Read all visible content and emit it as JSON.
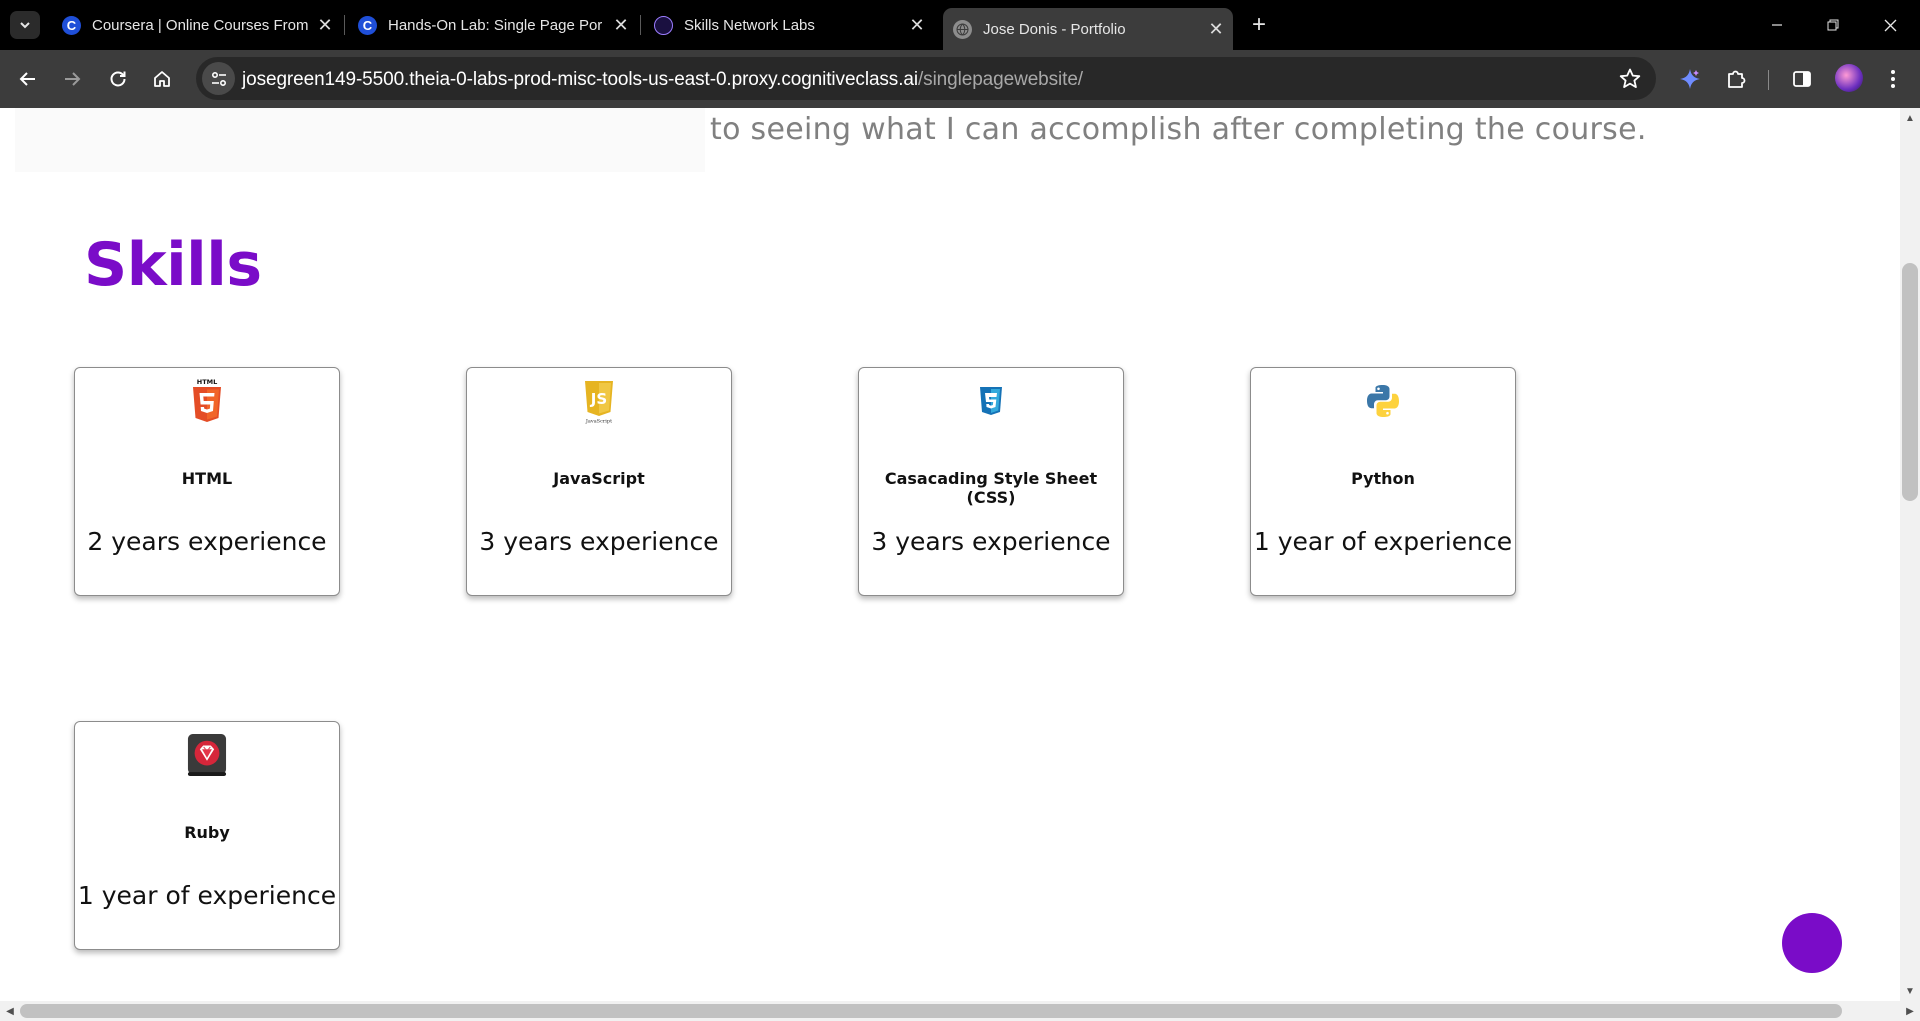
{
  "browser": {
    "tabs": [
      {
        "title": "Coursera | Online Courses From",
        "active": false
      },
      {
        "title": "Hands-On Lab: Single Page Por",
        "active": false
      },
      {
        "title": "Skills Network Labs",
        "active": false
      },
      {
        "title": "Jose Donis - Portfolio",
        "active": true
      }
    ],
    "url_host": "josegreen149-5500.theia-0-labs-prod-misc-tools-us-east-0.proxy.cognitiveclass.ai",
    "url_path": "/singlepagewebsite/"
  },
  "page": {
    "about_text": "to seeing what I can accomplish after completing the course.",
    "skills_heading": "Skills",
    "skills": [
      {
        "name": "HTML",
        "experience": "2 years experience",
        "icon": "html5-logo-icon"
      },
      {
        "name": "JavaScript",
        "experience": "3 years experience",
        "icon": "javascript-logo-icon"
      },
      {
        "name": "Casacading Style Sheet (CSS)",
        "experience": "3 years experience",
        "icon": "css3-logo-icon"
      },
      {
        "name": "Python",
        "experience": "1 year of experience",
        "icon": "python-logo-icon"
      },
      {
        "name": "Ruby",
        "experience": "1 year of experience",
        "icon": "ruby-logo-icon"
      }
    ],
    "accent_color": "#7a0cc8"
  }
}
